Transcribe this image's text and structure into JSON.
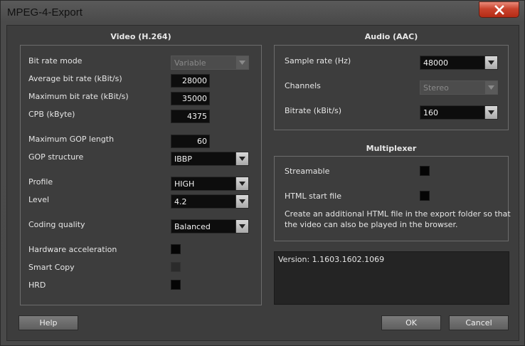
{
  "window": {
    "title": "MPEG-4-Export"
  },
  "video": {
    "section_title": "Video (H.264)",
    "bit_rate_mode": {
      "label": "Bit rate mode",
      "value": "Variable"
    },
    "average_bit_rate": {
      "label": "Average bit rate (kBit/s)",
      "value": "28000"
    },
    "maximum_bit_rate": {
      "label": "Maximum bit rate (kBit/s)",
      "value": "35000"
    },
    "cpb": {
      "label": "CPB (kByte)",
      "value": "4375"
    },
    "max_gop_length": {
      "label": "Maximum GOP length",
      "value": "60"
    },
    "gop_structure": {
      "label": "GOP structure",
      "value": "IBBP"
    },
    "profile": {
      "label": "Profile",
      "value": "HIGH"
    },
    "level": {
      "label": "Level",
      "value": "4.2"
    },
    "coding_quality": {
      "label": "Coding quality",
      "value": "Balanced"
    },
    "hardware_acceleration": {
      "label": "Hardware acceleration"
    },
    "smart_copy": {
      "label": "Smart Copy"
    },
    "hrd": {
      "label": "HRD"
    }
  },
  "audio": {
    "section_title": "Audio (AAC)",
    "sample_rate": {
      "label": "Sample rate (Hz)",
      "value": "48000"
    },
    "channels": {
      "label": "Channels",
      "value": "Stereo"
    },
    "bitrate": {
      "label": "Bitrate (kBit/s)",
      "value": "160"
    }
  },
  "multiplexer": {
    "section_title": "Multiplexer",
    "streamable": {
      "label": "Streamable"
    },
    "html_start_file": {
      "label": "HTML start file"
    },
    "description": "Create an additional HTML file in the export folder so that the video can also be played in the browser."
  },
  "version_text": "Version: 1.1603.1602.1069",
  "buttons": {
    "help": "Help",
    "ok": "OK",
    "cancel": "Cancel"
  }
}
